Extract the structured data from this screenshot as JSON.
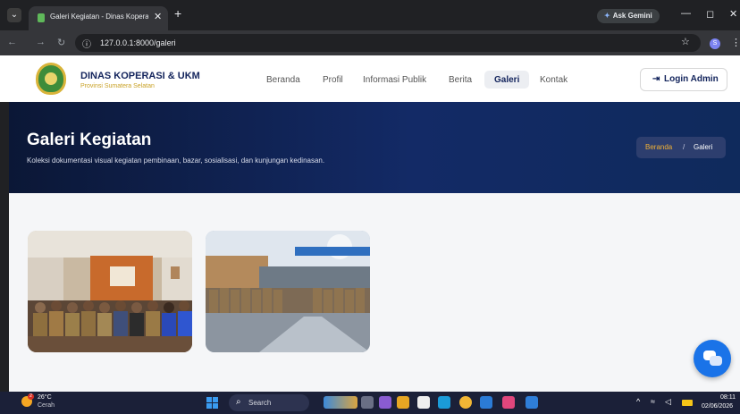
{
  "browser": {
    "tab_title": "Galeri Kegiatan - Dinas Kopera",
    "url": "127.0.0.1:8000/galeri",
    "gemini_label": "Ask Gemini",
    "profile_initial": "S"
  },
  "header": {
    "brand_title": "DINAS KOPERASI & UKM",
    "brand_subtitle": "Provinsi Sumatera Selatan",
    "nav": [
      "Beranda",
      "Profil",
      "Informasi Publik",
      "Berita",
      "Galeri",
      "Kontak"
    ],
    "active_nav": "Galeri",
    "login_label": "Login Admin"
  },
  "hero": {
    "title": "Galeri Kegiatan",
    "subtitle": "Koleksi dokumentasi visual kegiatan pembinaan, bazar, sosialisasi, dan kunjungan kedinasan.",
    "breadcrumb_home": "Beranda",
    "breadcrumb_separator": "/",
    "breadcrumb_current": "Galeri"
  },
  "taskbar": {
    "temperature": "26°C",
    "condition": "Cerah",
    "search_label": "Search",
    "time": "08:11",
    "date": "02/06/2026",
    "weather_badge": "2"
  },
  "colors": {
    "navy": "#13245c",
    "gold": "#c9a227",
    "chat_button": "#1a73e8"
  }
}
